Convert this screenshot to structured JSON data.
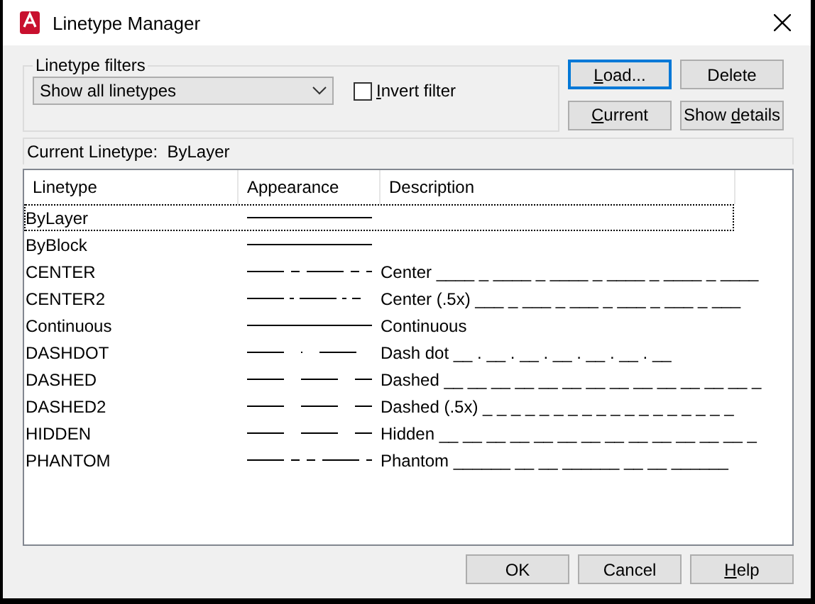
{
  "window": {
    "title": "Linetype Manager"
  },
  "filters": {
    "legend": "Linetype filters",
    "dropdown": "Show all linetypes",
    "invert": {
      "key": "I",
      "post": "nvert filter",
      "checked": false
    }
  },
  "buttons_top": [
    {
      "key": "L",
      "post": "oad...",
      "focused": true
    },
    {
      "pre": "Delete",
      "focused": false
    },
    {
      "key": "C",
      "post": "urrent",
      "focused": false
    },
    {
      "pre": "Show ",
      "key": "d",
      "post": "etails",
      "focused": false
    }
  ],
  "current_linetype": "Current Linetype:  ByLayer",
  "table": {
    "columns": [
      "Linetype",
      "Appearance",
      "Description"
    ],
    "rows": [
      {
        "name": "ByLayer",
        "kind": "solid",
        "focused": true
      },
      {
        "name": "ByBlock",
        "kind": "solid",
        "focused": false
      },
      {
        "name": "CENTER",
        "kind": "center",
        "description": "Center ____ _ ____ _ ____ _ ____ _ ____ _ ____",
        "focused": false
      },
      {
        "name": "CENTER2",
        "kind": "center2",
        "description": "Center (.5x) ___ _ ___ _ ___ _ ___ _ ___ _ ___",
        "focused": false
      },
      {
        "name": "Continuous",
        "kind": "continuous",
        "description": "Continuous",
        "focused": false
      },
      {
        "name": "DASHDOT",
        "kind": "dashdot",
        "description": "Dash dot __ . __ . __ . __ . __ . __ . __",
        "focused": false
      },
      {
        "name": "DASHED",
        "kind": "dashed",
        "description": "Dashed __ __ __ __ __ __ __ __ __ __ __ __ __ _",
        "focused": false
      },
      {
        "name": "DASHED2",
        "kind": "dashed",
        "description": "Dashed (.5x) _ _ _ _ _ _ _ _ _ _ _ _ _ _ _ _ _ _",
        "focused": false
      },
      {
        "name": "HIDDEN",
        "kind": "dashed",
        "description": "Hidden __ __ __ __ __ __ __ __ __ __ __ __ __ _",
        "focused": false
      },
      {
        "name": "PHANTOM",
        "kind": "phantom",
        "description": "Phantom ______  __  __  ______  __  __  ______",
        "focused": false
      }
    ]
  },
  "buttons_bottom": [
    {
      "pre": "OK"
    },
    {
      "pre": "Cancel"
    },
    {
      "key": "H",
      "post": "elp"
    }
  ]
}
